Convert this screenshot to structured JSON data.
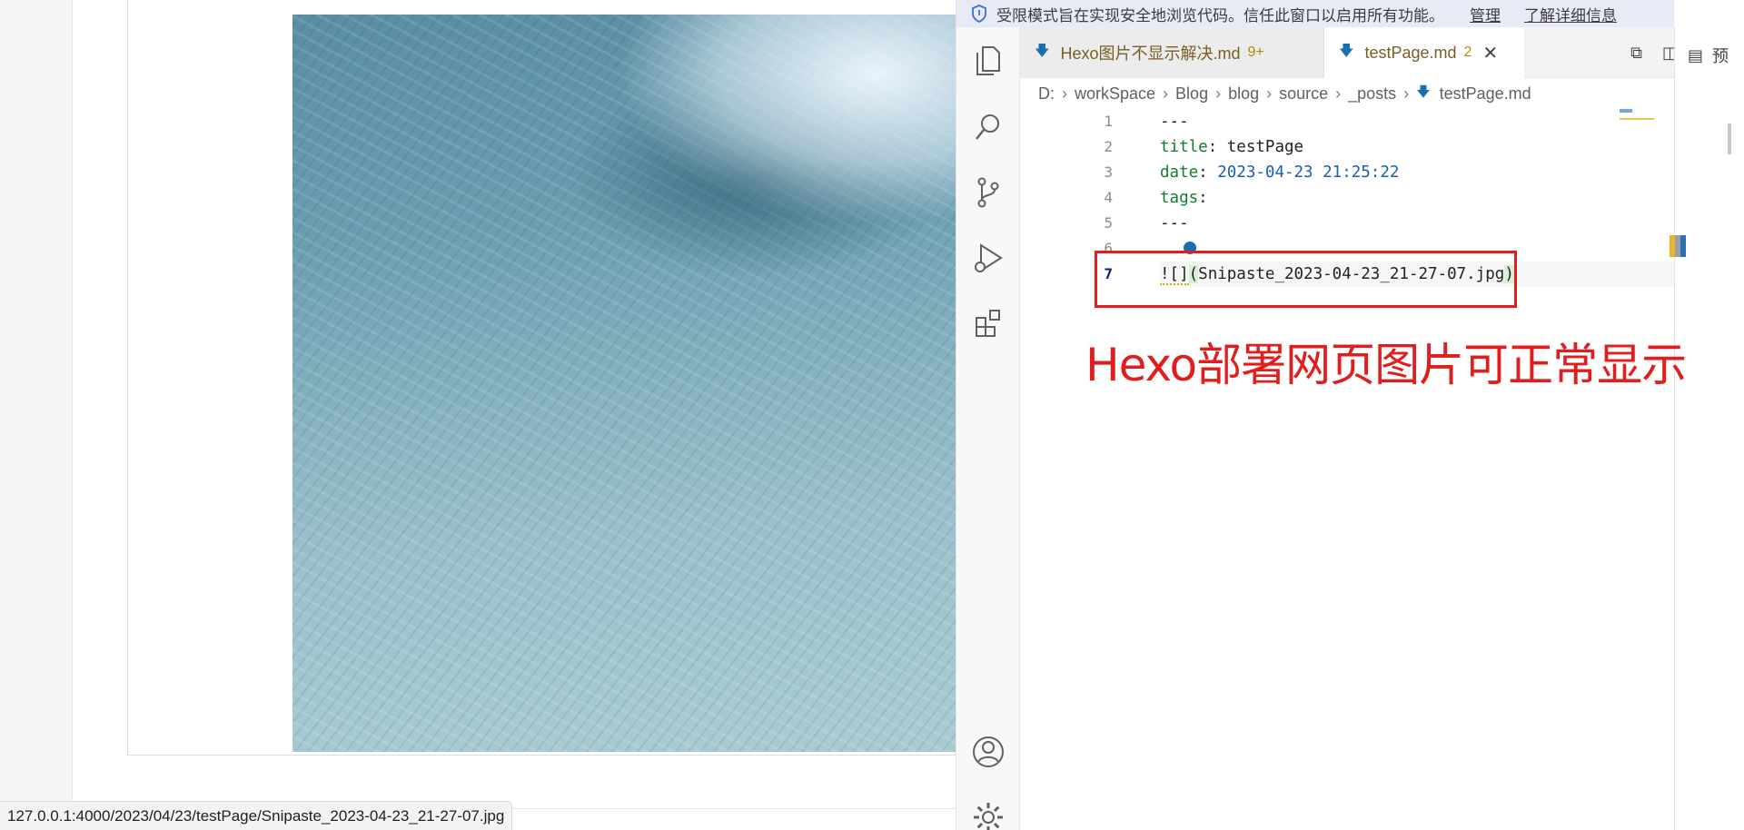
{
  "browser": {
    "status_url": "127.0.0.1:4000/2023/04/23/testPage/Snipaste_2023-04-23_21-27-07.jpg"
  },
  "vscode": {
    "banner": {
      "message": "受限模式旨在实现安全地浏览代码。信任此窗口以启用所有功能。",
      "manage": "管理",
      "learn_more": "了解详细信息"
    },
    "tabs": [
      {
        "label": "Hexo图片不显示解决.md",
        "count": "9+"
      },
      {
        "label": "testPage.md",
        "count": "2"
      }
    ],
    "preview_label": "预",
    "breadcrumb": [
      "D:",
      "workSpace",
      "Blog",
      "blog",
      "source",
      "_posts",
      "testPage.md"
    ],
    "editor": {
      "lines": [
        {
          "number": "1",
          "text": "---"
        },
        {
          "number": "2",
          "key": "title",
          "value": "testPage"
        },
        {
          "number": "3",
          "key": "date",
          "value": "2023-04-23 21:25:22"
        },
        {
          "number": "4",
          "key": "tags",
          "value": ""
        },
        {
          "number": "5",
          "text": "---"
        },
        {
          "number": "6",
          "text": ""
        },
        {
          "number": "7",
          "prefix": "![]",
          "link": "Snipaste_2023-04-23_21-27-07.jpg"
        }
      ],
      "active_line": 7
    },
    "annotation": "Hexo部署网页图片可正常显示"
  },
  "colors": {
    "annotation_red": "#e01e1e",
    "banner_bg": "#e8eaf6",
    "yaml_key": "#0f7f2f",
    "yaml_date": "#1a5fb4"
  },
  "icons": [
    "shield-icon",
    "explorer-icon",
    "search-icon",
    "source-control-icon",
    "run-debug-icon",
    "extensions-icon",
    "account-icon",
    "settings-gear-icon",
    "markdown-icon",
    "close-icon",
    "open-preview-icon",
    "split-editor-icon",
    "more-actions-icon",
    "preview-icon",
    "chevron-right-icon"
  ]
}
